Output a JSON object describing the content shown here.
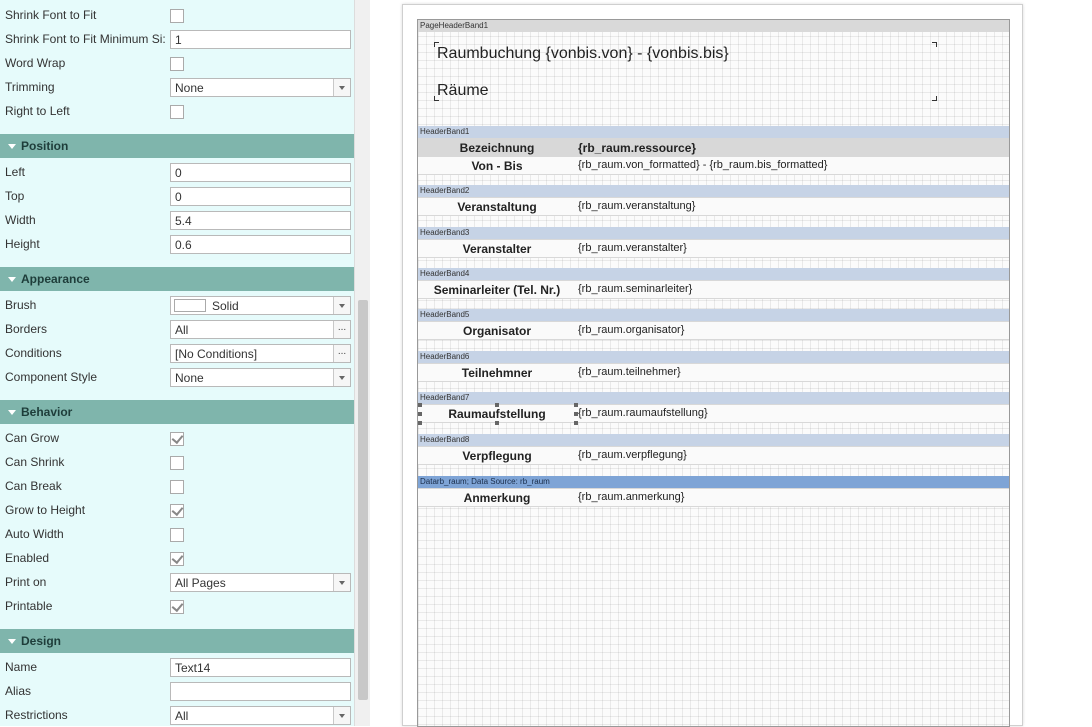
{
  "properties": {
    "text_rows": {
      "shrink_font_to_fit": {
        "label": "Shrink Font to Fit",
        "checked": false
      },
      "shrink_font_min": {
        "label": "Shrink Font to Fit Minimum Si:",
        "value": "1"
      },
      "word_wrap": {
        "label": "Word Wrap",
        "checked": false
      },
      "trimming": {
        "label": "Trimming",
        "value": "None"
      },
      "right_to_left": {
        "label": "Right to Left",
        "checked": false
      }
    },
    "position": {
      "title": "Position",
      "left": {
        "label": "Left",
        "value": "0"
      },
      "top": {
        "label": "Top",
        "value": "0"
      },
      "width": {
        "label": "Width",
        "value": "5.4"
      },
      "height": {
        "label": "Height",
        "value": "0.6"
      }
    },
    "appearance": {
      "title": "Appearance",
      "brush": {
        "label": "Brush",
        "value": "Solid",
        "swatch_color": "#ffffff"
      },
      "borders": {
        "label": "Borders",
        "value": "All"
      },
      "conditions": {
        "label": "Conditions",
        "value": "[No Conditions]"
      },
      "component_style": {
        "label": "Component Style",
        "value": "None"
      }
    },
    "behavior": {
      "title": "Behavior",
      "can_grow": {
        "label": "Can Grow",
        "checked": true
      },
      "can_shrink": {
        "label": "Can Shrink",
        "checked": false
      },
      "can_break": {
        "label": "Can Break",
        "checked": false
      },
      "grow_to_height": {
        "label": "Grow to Height",
        "checked": true
      },
      "auto_width": {
        "label": "Auto Width",
        "checked": false
      },
      "enabled": {
        "label": "Enabled",
        "checked": true
      },
      "print_on": {
        "label": "Print on",
        "value": "All Pages"
      },
      "printable": {
        "label": "Printable",
        "checked": true
      }
    },
    "design": {
      "title": "Design",
      "name": {
        "label": "Name",
        "value": "Text14"
      },
      "alias": {
        "label": "Alias",
        "value": ""
      },
      "restrictions": {
        "label": "Restrictions",
        "value": "All"
      }
    },
    "ellipsis": "..."
  },
  "report": {
    "page_header": {
      "band_name": "PageHeaderBand1",
      "title": "Raumbuchung {vonbis.von} - {vonbis.bis}",
      "subtitle": "Räume"
    },
    "bands": [
      {
        "name": "HeaderBand1",
        "rows": [
          {
            "label": "Bezeichnung",
            "field": "{rb_raum.ressource}"
          },
          {
            "label": "Von - Bis",
            "field": "{rb_raum.von_formatted} - {rb_raum.bis_formatted}"
          }
        ]
      },
      {
        "name": "HeaderBand2",
        "rows": [
          {
            "label": "Veranstaltung",
            "field": "{rb_raum.veranstaltung}"
          }
        ]
      },
      {
        "name": "HeaderBand3",
        "rows": [
          {
            "label": "Veranstalter",
            "field": "{rb_raum.veranstalter}"
          }
        ]
      },
      {
        "name": "HeaderBand4",
        "rows": [
          {
            "label": "Seminarleiter (Tel. Nr.)",
            "field": "{rb_raum.seminarleiter}"
          }
        ]
      },
      {
        "name": "HeaderBand5",
        "rows": [
          {
            "label": "Organisator",
            "field": "{rb_raum.organisator}"
          }
        ]
      },
      {
        "name": "HeaderBand6",
        "rows": [
          {
            "label": "Teilnehmner",
            "field": "{rb_raum.teilnehmer}"
          }
        ]
      },
      {
        "name": "HeaderBand7",
        "rows": [
          {
            "label": "Raumaufstellung",
            "field": "{rb_raum.raumaufstellung}"
          }
        ]
      },
      {
        "name": "HeaderBand8",
        "rows": [
          {
            "label": "Verpflegung",
            "field": "{rb_raum.verpflegung}"
          }
        ]
      },
      {
        "name": "Datarb_raum; Data Source: rb_raum",
        "rows": [
          {
            "label": "Anmerkung",
            "field": "{rb_raum.anmerkung}"
          }
        ]
      }
    ]
  },
  "colors": {
    "grid_background": "#e6fbfb",
    "category_header": "#7fb5ac",
    "band_header": "#c6d3e6",
    "data_band_header": "#7ea4d6",
    "bezeichnung_row": "#d8d8d8"
  }
}
